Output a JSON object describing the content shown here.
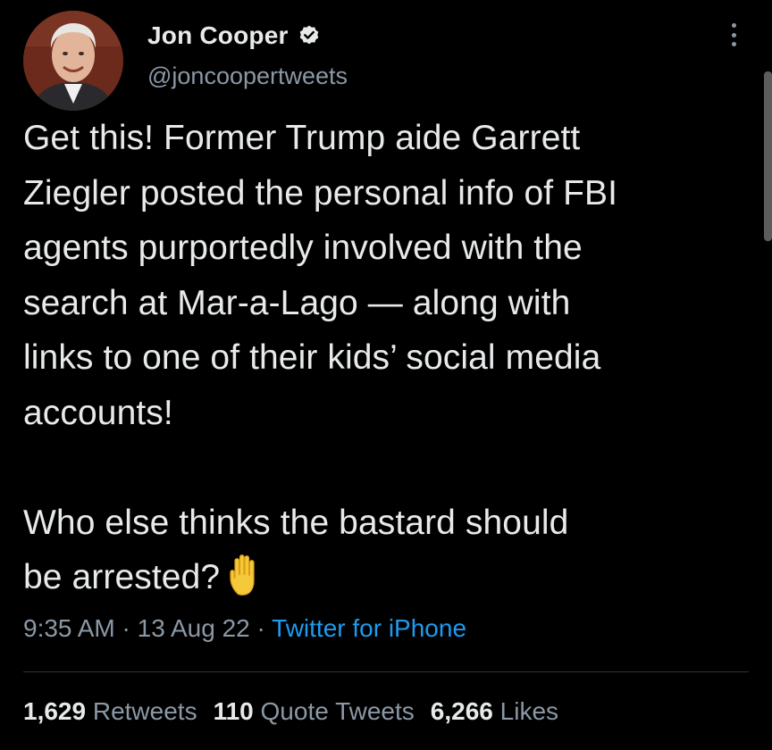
{
  "author": {
    "display_name": "Jon Cooper",
    "handle": "@joncoopertweets",
    "verified_badge_icon": "verified-badge-icon",
    "avatar_icon": "avatar-portrait"
  },
  "tweet": {
    "line1": "Get this! Former Trump aide Garrett",
    "line2": "Ziegler posted the personal info of FBI",
    "line3": "agents purportedly involved with the",
    "line4": "search at Mar-a-Lago — along with",
    "line5": "links to one of their kids’ social media",
    "line6": "accounts!",
    "line7": "Who else thinks the bastard should",
    "line8": "be arrested?",
    "emoji_icon": "raised-hand-emoji"
  },
  "meta": {
    "time": "9:35 AM",
    "sep1": " · ",
    "date": "13 Aug 22",
    "sep2": " · ",
    "source": "Twitter for iPhone"
  },
  "stats": {
    "retweets_count": "1,629",
    "retweets_label": "Retweets",
    "quotes_count": "110",
    "quotes_label": "Quote Tweets",
    "likes_count": "6,266",
    "likes_label": "Likes"
  },
  "colors": {
    "background": "#000000",
    "text_primary": "#e7e9ea",
    "text_secondary": "#8b98a5",
    "link": "#1d9bf0",
    "divider": "#2f3336"
  }
}
